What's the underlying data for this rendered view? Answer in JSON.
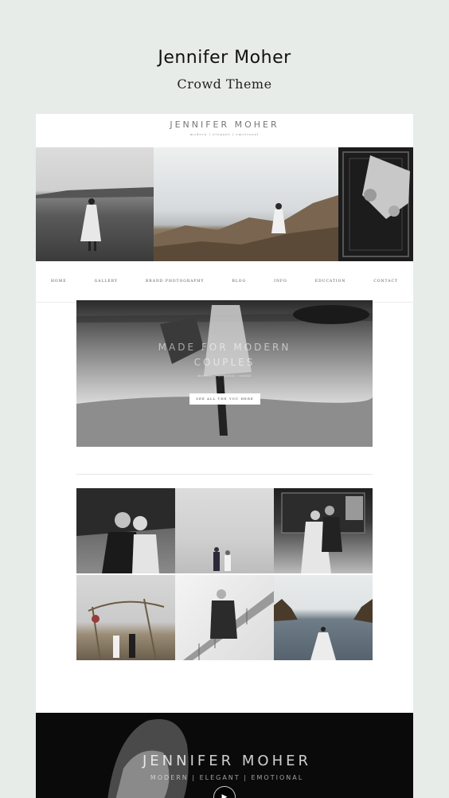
{
  "promo": {
    "title": "Jennifer Moher",
    "subtitle": "Crowd Theme"
  },
  "site": {
    "logo": "JENNIFER MOHER",
    "tagline": "modern | elegant | emotional"
  },
  "nav": {
    "items": [
      "HOME",
      "GALLERY",
      "BRAND PHOTOGRAPHY",
      "BLOG",
      "INFO",
      "EDUCATION",
      "CONTACT"
    ]
  },
  "feature": {
    "heading_line1": "MADE FOR MODERN",
    "heading_line2": "COUPLES",
    "sub": "modern, emotional, candid",
    "button": "SEE ALL THE YOU HERE"
  },
  "footer": {
    "logo": "JENNIFER MOHER",
    "tagline": "MODERN | ELEGANT | EMOTIONAL",
    "play_icon": "▶"
  },
  "colors": {
    "page_bg": "#e7ece8",
    "card_bg": "#ffffff",
    "footer_bg": "#0a0a0a"
  }
}
